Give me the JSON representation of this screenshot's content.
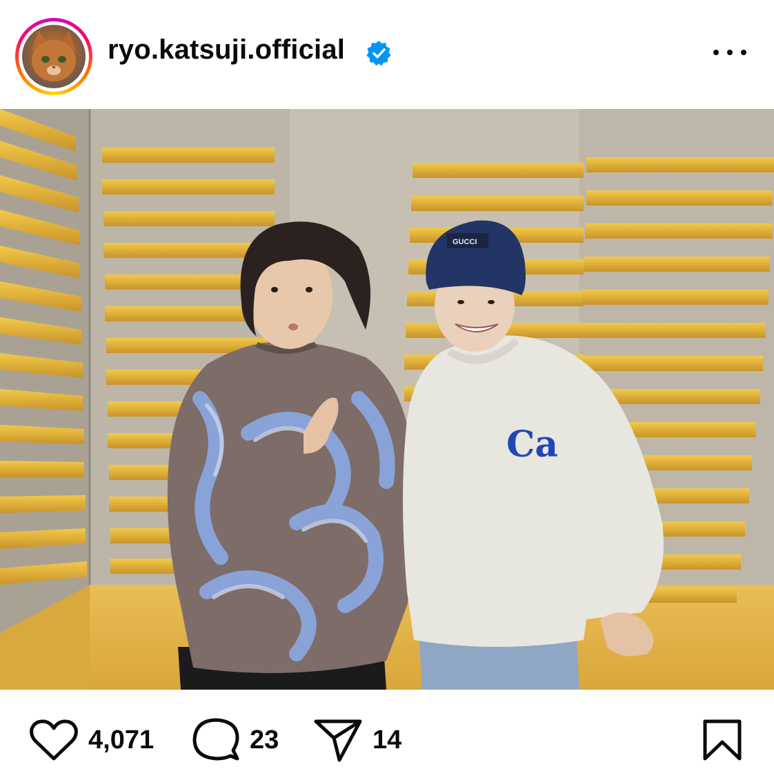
{
  "post": {
    "username": "ryo.katsuji.official",
    "verified": true,
    "avatar_icon": "cat-avatar",
    "more_icon": "more-horizontal-icon",
    "photo_text": {
      "beanie_brand": "GUCCI",
      "sweater_logo": "Ca"
    }
  },
  "actions": {
    "likes": "4,071",
    "comments": "23",
    "shares": "14",
    "like_icon": "heart-icon",
    "comment_icon": "comment-icon",
    "share_icon": "send-icon",
    "save_icon": "bookmark-icon"
  },
  "colors": {
    "verified_blue": "#0095f6",
    "text": "#0a0a0a",
    "wall_slat": "#e9b93a",
    "wall_panel": "#b9b3a6"
  }
}
